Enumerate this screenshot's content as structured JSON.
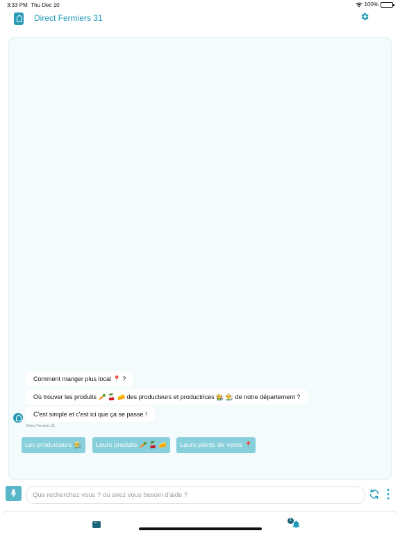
{
  "status_bar": {
    "time": "3:33 PM",
    "date": "Thu Dec 10",
    "battery": "100%"
  },
  "header": {
    "title": "Direct Fermiers 31"
  },
  "chat": {
    "messages": [
      "Comment manger plus local 📍 ?",
      "Où trouver les produits 🥕 🍒 🧀 des producteurs et productrices 👩‍🌾 👨‍🌾 de notre département ?",
      "C'est simple et c'est ici que ça se passe !"
    ],
    "sender": "Direct Fermiers 31",
    "quick_replies": [
      "Les producteurs 👨‍🌾",
      "Leurs produits 🥕 🍒 🧀",
      "Leurs points de vente 📍"
    ]
  },
  "input": {
    "placeholder": "Que recherchez vous ? ou avez vous besoin d'aide ?"
  },
  "tab_bar": {
    "notification_count": "1"
  },
  "colors": {
    "brand": "#1f9ab8",
    "quick_reply_bg": "#88cfdc",
    "panel_bg": "#f3fbfc"
  },
  "icons": [
    "wifi-icon",
    "battery-icon",
    "app-logo-icon",
    "gear-icon",
    "bot-avatar-icon",
    "mic-icon",
    "refresh-icon",
    "more-vertical-icon",
    "chat-icon",
    "bell-icon"
  ]
}
